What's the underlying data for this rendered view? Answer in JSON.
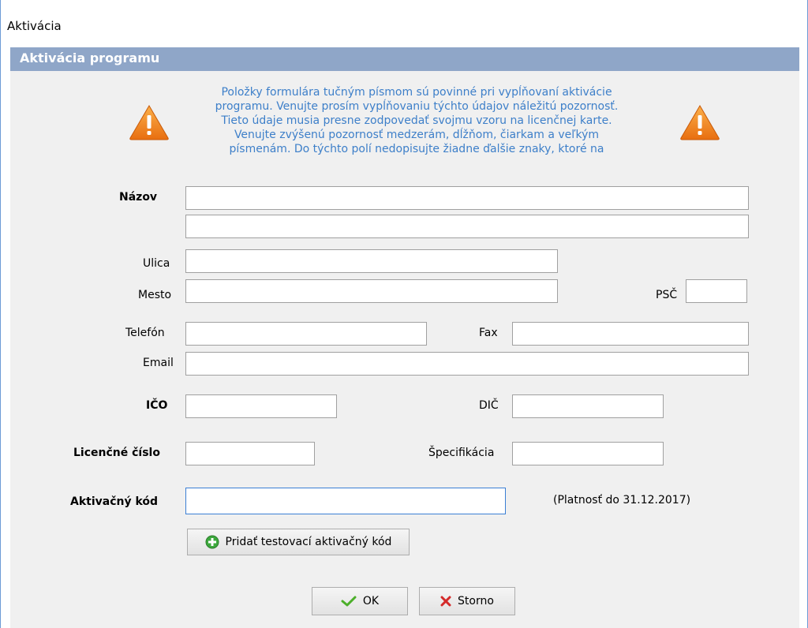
{
  "window": {
    "title": "Aktivácia"
  },
  "header": {
    "title": "Aktivácia programu"
  },
  "notice": {
    "lines": [
      "Položky formulára tučným písmom sú  povinné pri vypĺňovaní aktivácie",
      "programu. Venujte prosím vypĺňovaniu týchto údajov náležitú pozornosť.",
      "Tieto údaje musia presne zodpovedať svojmu vzoru na licenčnej karte.",
      "Venujte zvýšenú pozornosť medzerám, dĺžňom, čiarkam a veľkým",
      "písmenám. Do týchto polí nedopisujte žiadne ďalšie znaky, ktoré na"
    ],
    "icon": "warning-triangle-icon",
    "color": "#3d7fc9"
  },
  "form": {
    "nazov": {
      "label": "Názov",
      "value1": "",
      "value2": ""
    },
    "ulica": {
      "label": "Ulica",
      "value": ""
    },
    "mesto": {
      "label": "Mesto",
      "value": ""
    },
    "psc": {
      "label": "PSČ",
      "value": ""
    },
    "telefon": {
      "label": "Telefón",
      "value": ""
    },
    "fax": {
      "label": "Fax",
      "value": ""
    },
    "email": {
      "label": "Email",
      "value": ""
    },
    "ico": {
      "label": "IČO",
      "value": ""
    },
    "dic": {
      "label": "DIČ",
      "value": ""
    },
    "licencne_cislo": {
      "label": "Licenčné číslo",
      "value": ""
    },
    "specifikacia": {
      "label": "Špecifikácia",
      "value": ""
    },
    "aktivacny_kod": {
      "label": "Aktivačný kód",
      "value": ""
    },
    "platnost": "(Platnosť do 31.12.2017)"
  },
  "buttons": {
    "add_test_code": {
      "label": "Pridať testovací aktivačný kód",
      "icon": "plus-circle-icon"
    },
    "ok": {
      "label": "OK",
      "icon": "checkmark-icon"
    },
    "storno": {
      "label": "Storno",
      "icon": "x-icon"
    }
  },
  "colors": {
    "header_bg": "#8fa6c8",
    "content_bg": "#f0f0f0",
    "notice_text": "#3d7fc9",
    "focus_border": "#3b7fd4"
  }
}
